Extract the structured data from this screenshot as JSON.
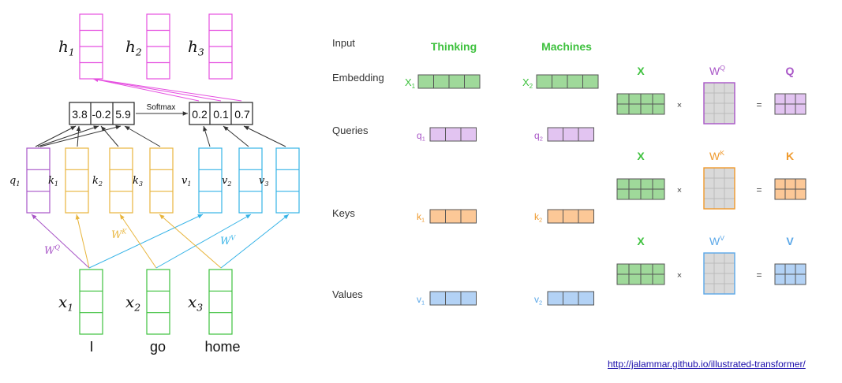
{
  "colors": {
    "purple": "#a855c7",
    "purple_fill": "#e2c4f1",
    "magenta": "#e54fe0",
    "yellow": "#e8b53c",
    "cyan": "#35b3e7",
    "green": "#3ec13e",
    "green_fill": "#9fd99a",
    "orange": "#ef9a2e",
    "orange_fill": "#fcc897",
    "blue": "#5aa7e8",
    "blue_fill": "#b3d2f5",
    "gray_fill": "#d9d9d9",
    "dark": "#333333"
  },
  "left": {
    "outputs": [
      {
        "base": "h",
        "sub": "1"
      },
      {
        "base": "h",
        "sub": "2"
      },
      {
        "base": "h",
        "sub": "3"
      }
    ],
    "scores": [
      "3.8",
      "-0.2",
      "5.9"
    ],
    "softmax_label": "Softmax",
    "probs": [
      "0.2",
      "0.1",
      "0.7"
    ],
    "vectors": [
      {
        "base": "q",
        "sub": "1",
        "color": "purple"
      },
      {
        "base": "k",
        "sub": "1",
        "color": "yellow"
      },
      {
        "base": "k",
        "sub": "2",
        "color": "yellow"
      },
      {
        "base": "k",
        "sub": "3",
        "color": "yellow"
      },
      {
        "base": "v",
        "sub": "1",
        "color": "cyan"
      },
      {
        "base": "v",
        "sub": "2",
        "color": "cyan"
      },
      {
        "base": "v",
        "sub": "3",
        "color": "cyan"
      }
    ],
    "weights": [
      {
        "base": "W",
        "sup": "Q",
        "color": "purple"
      },
      {
        "base": "W",
        "sup": "K",
        "color": "yellow"
      },
      {
        "base": "W",
        "sup": "V",
        "color": "cyan"
      }
    ],
    "inputs": [
      {
        "base": "x",
        "sub": "1"
      },
      {
        "base": "x",
        "sub": "2"
      },
      {
        "base": "x",
        "sub": "3"
      }
    ],
    "words": [
      "I",
      "go",
      "home"
    ]
  },
  "middle": {
    "row_labels": [
      "Input",
      "Embedding",
      "Queries",
      "Keys",
      "Values"
    ],
    "words": [
      "Thinking",
      "Machines"
    ],
    "embeddings": [
      {
        "base": "X",
        "sub": "1"
      },
      {
        "base": "X",
        "sub": "2"
      }
    ],
    "queries": [
      {
        "base": "q",
        "sub": "1"
      },
      {
        "base": "q",
        "sub": "2"
      }
    ],
    "keys": [
      {
        "base": "k",
        "sub": "1"
      },
      {
        "base": "k",
        "sub": "2"
      }
    ],
    "values": [
      {
        "base": "v",
        "sub": "1"
      },
      {
        "base": "v",
        "sub": "2"
      }
    ]
  },
  "right": {
    "rows": [
      {
        "x_label": "X",
        "w_base": "W",
        "w_sup": "Q",
        "out_label": "Q",
        "color": "purple"
      },
      {
        "x_label": "X",
        "w_base": "W",
        "w_sup": "K",
        "out_label": "K",
        "color": "orange"
      },
      {
        "x_label": "X",
        "w_base": "W",
        "w_sup": "V",
        "out_label": "V",
        "color": "blue"
      }
    ],
    "times": "×",
    "equals": "="
  },
  "link": {
    "text": "http://jalammar.github.io/illustrated-transformer/"
  }
}
